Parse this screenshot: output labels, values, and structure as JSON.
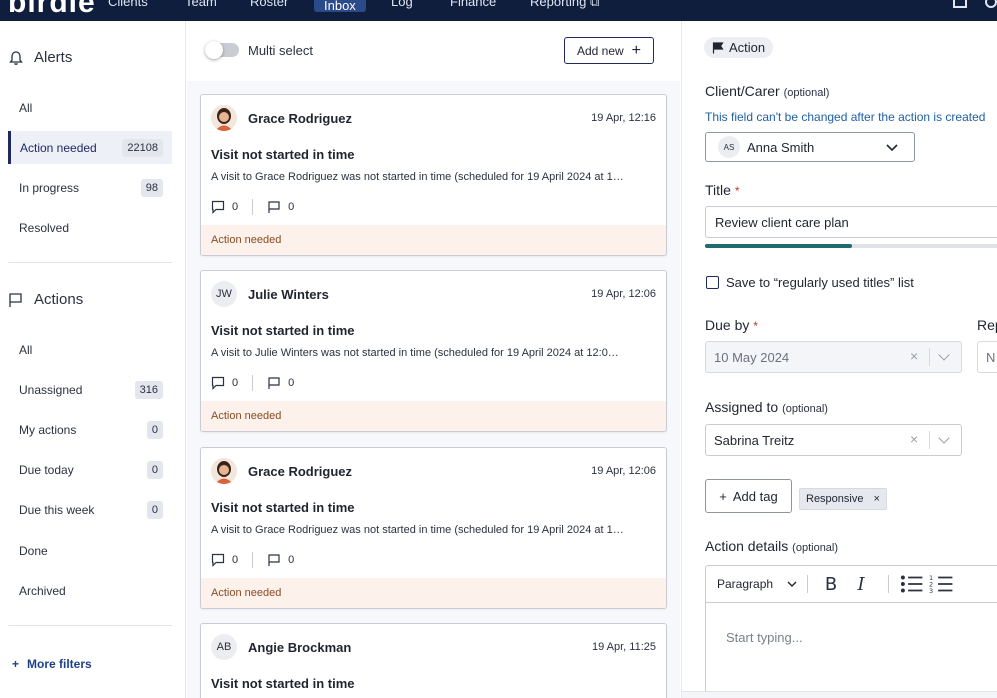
{
  "topnav": {
    "logo": "birdie",
    "items": [
      "Clients",
      "Team",
      "Roster",
      "Inbox",
      "Log",
      "Finance",
      "Reporting"
    ],
    "active": "Inbox"
  },
  "sidebar": {
    "alerts_header": "Alerts",
    "alerts": [
      {
        "label": "All",
        "count": null
      },
      {
        "label": "Action needed",
        "count": "22108",
        "active": true
      },
      {
        "label": "In progress",
        "count": "98"
      },
      {
        "label": "Resolved",
        "count": null
      }
    ],
    "actions_header": "Actions",
    "actions": [
      {
        "label": "All",
        "count": null
      },
      {
        "label": "Unassigned",
        "count": "316"
      },
      {
        "label": "My actions",
        "count": "0"
      },
      {
        "label": "Due today",
        "count": "0"
      },
      {
        "label": "Due this week",
        "count": "0"
      },
      {
        "label": "Done",
        "count": null
      },
      {
        "label": "Archived",
        "count": null
      }
    ],
    "more_filters": "More filters"
  },
  "middle": {
    "multi_select": "Multi select",
    "add_new": "Add new",
    "cards": [
      {
        "avatar": "photo",
        "name": "Grace Rodriguez",
        "date": "19 Apr, 12:16",
        "title": "Visit not started in time",
        "desc": "A visit to Grace Rodriguez was not started in time (scheduled for 19 April 2024 at 1…",
        "comments": "0",
        "flags": "0",
        "status": "Action needed"
      },
      {
        "avatar": "JW",
        "name": "Julie Winters",
        "date": "19 Apr, 12:06",
        "title": "Visit not started in time",
        "desc": "A visit to Julie Winters was not started in time (scheduled for 19 April 2024 at 12:0…",
        "comments": "0",
        "flags": "0",
        "status": "Action needed"
      },
      {
        "avatar": "photo",
        "name": "Grace Rodriguez",
        "date": "19 Apr, 12:06",
        "title": "Visit not started in time",
        "desc": "A visit to Grace Rodriguez was not started in time (scheduled for 19 April 2024 at 1…",
        "comments": "0",
        "flags": "0",
        "status": "Action needed"
      },
      {
        "avatar": "AB",
        "name": "Angie Brockman",
        "date": "19 Apr, 11:25",
        "title": "Visit not started in time",
        "desc": "",
        "comments": "",
        "flags": "",
        "status": ""
      }
    ]
  },
  "right": {
    "pill": "Action",
    "client_label": "Client/Carer",
    "client_optional": "(optional)",
    "client_hint": "This field can't be changed after the action is created",
    "client_initials": "AS",
    "client_value": "Anna Smith",
    "title_label": "Title",
    "title_value": "Review client care plan",
    "title_progress": 0.49,
    "save_label": "Save to “regularly used titles” list",
    "due_label": "Due by",
    "due_value": "10 May 2024",
    "rep_label": "Rep",
    "rep_value": "N",
    "assigned_label": "Assigned to",
    "assigned_optional": "(optional)",
    "assigned_value": "Sabrina Treitz",
    "add_tag": "Add tag",
    "tag": "Responsive",
    "details_label": "Action details",
    "details_optional": "(optional)",
    "paragraph": "Paragraph",
    "placeholder": "Start typing..."
  }
}
